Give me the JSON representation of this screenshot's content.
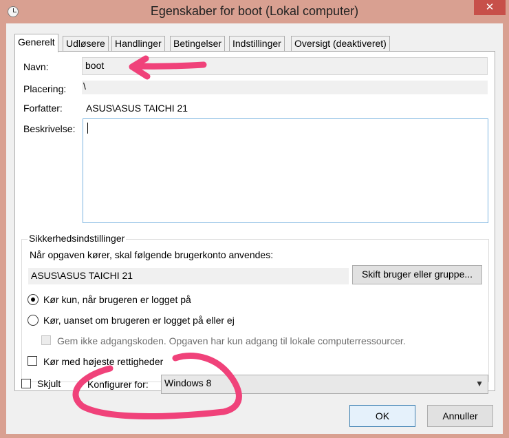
{
  "window": {
    "title": "Egenskaber for boot (Lokal computer)",
    "close_label": "✕"
  },
  "tabs": [
    {
      "label": "Generelt",
      "active": true
    },
    {
      "label": "Udløsere",
      "active": false
    },
    {
      "label": "Handlinger",
      "active": false
    },
    {
      "label": "Betingelser",
      "active": false
    },
    {
      "label": "Indstillinger",
      "active": false
    },
    {
      "label": "Oversigt (deaktiveret)",
      "active": false
    }
  ],
  "general": {
    "name_label": "Navn:",
    "name_value": "boot",
    "location_label": "Placering:",
    "location_value": "\\",
    "author_label": "Forfatter:",
    "author_value": "ASUS\\ASUS TAICHI 21",
    "description_label": "Beskrivelse:",
    "description_value": ""
  },
  "security": {
    "group_title": "Sikkerhedsindstillinger",
    "account_prompt": "Når opgaven kører, skal følgende brugerkonto anvendes:",
    "account_value": "ASUS\\ASUS TAICHI 21",
    "change_user_button": "Skift bruger eller gruppe...",
    "radio_logged_on": "Kør kun, når brugeren er logget på",
    "radio_any": "Kør, uanset om brugeren er logget på eller ej",
    "no_password_checkbox": "Gem ikke adgangskoden. Opgaven har kun adgang til lokale computerressourcer.",
    "highest_privileges_checkbox": "Kør med højeste rettigheder"
  },
  "bottom": {
    "hidden_checkbox": "Skjult",
    "configure_label": "Konfigurer for:",
    "configure_value": "Windows 8"
  },
  "buttons": {
    "ok": "OK",
    "cancel": "Annuller"
  },
  "colors": {
    "titlebar": "#d9a091",
    "close_button": "#c7504a",
    "annotation": "#f0427a",
    "focus_border": "#7ab3e0"
  }
}
